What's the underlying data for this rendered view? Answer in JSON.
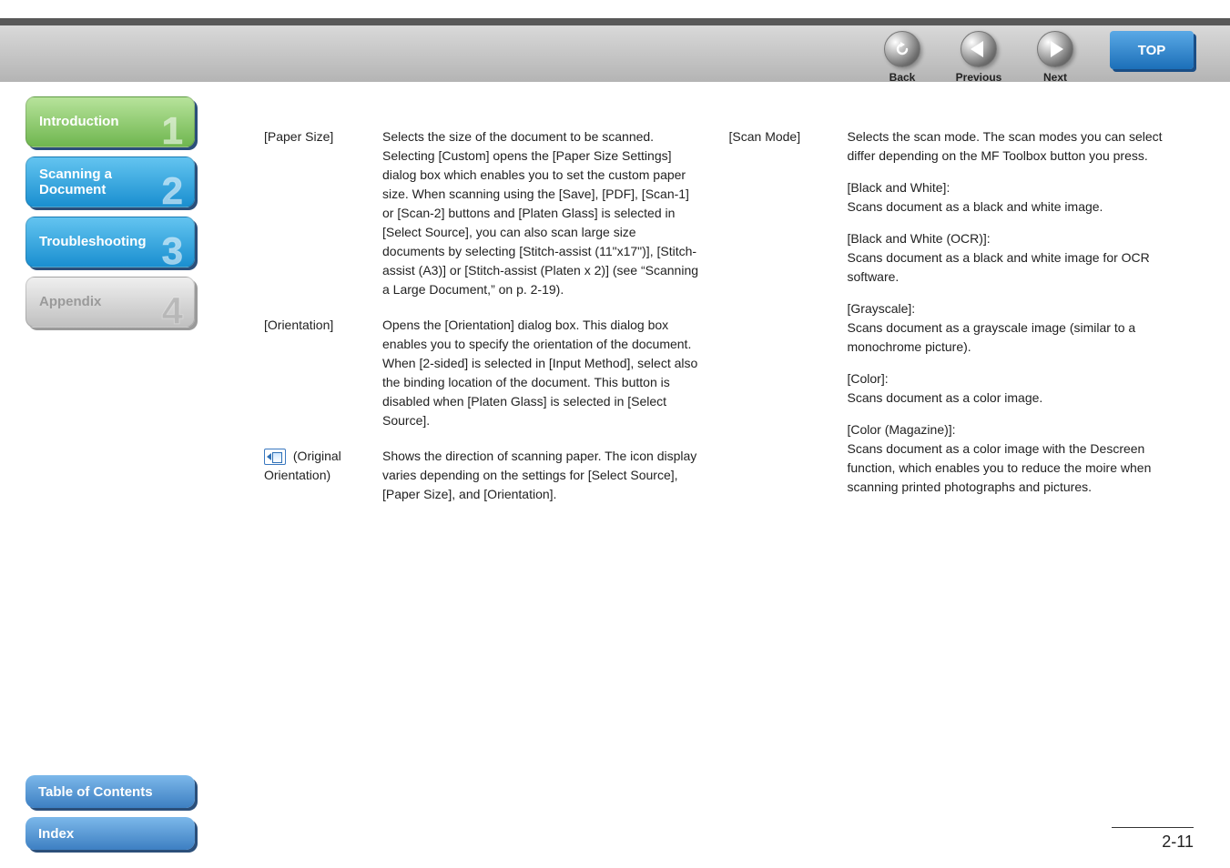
{
  "topnav": {
    "back": "Back",
    "previous": "Previous",
    "next": "Next",
    "top": "TOP"
  },
  "sidebar": {
    "items": [
      {
        "label": "Introduction",
        "num": "1"
      },
      {
        "label": "Scanning a Document",
        "num": "2"
      },
      {
        "label": "Troubleshooting",
        "num": "3"
      },
      {
        "label": "Appendix",
        "num": "4"
      }
    ]
  },
  "bottom": {
    "toc": "Table of Contents",
    "index": "Index"
  },
  "pageno": "2-11",
  "left_col": [
    {
      "term": "[Paper Size]",
      "desc": "Selects the size of the document to be scanned. Selecting [Custom] opens the [Paper Size Settings] dialog box which enables you to set the custom paper size. When scanning using the [Save], [PDF], [Scan-1] or [Scan-2] buttons and [Platen Glass] is selected in [Select Source], you can also scan large size documents by selecting [Stitch-assist (11\"x17\")], [Stitch-assist (A3)] or [Stitch-assist (Platen x 2)] (see “Scanning a Large Document,” on p. 2-19)."
    },
    {
      "term": "[Orientation]",
      "desc": "Opens the [Orientation] dialog box. This dialog box enables you to specify the orientation of the document. When [2-sided] is selected in [Input Method], select also the binding location of the document. This button is disabled when [Platen Glass] is selected in [Select Source]."
    },
    {
      "term": " (Original Orientation)",
      "has_icon": true,
      "desc": "Shows the direction of scanning paper. The icon display varies depending on the settings for [Select Source], [Paper Size], and [Orientation]."
    }
  ],
  "right_col": {
    "term": "[Scan Mode]",
    "desc": "Selects the scan mode. The scan modes you can select differ depending on the MF Toolbox button you press.",
    "modes": [
      {
        "head": "[Black and White]:",
        "body": "Scans document as a black and white image."
      },
      {
        "head": "[Black and White (OCR)]:",
        "body": "Scans document as a black and white image for OCR software."
      },
      {
        "head": "[Grayscale]:",
        "body": "Scans document as a grayscale image (similar to a monochrome picture)."
      },
      {
        "head": "[Color]:",
        "body": "Scans document as a color image."
      },
      {
        "head": "[Color (Magazine)]:",
        "body": "Scans document as a color image with the Descreen function, which enables you to reduce the moire when scanning printed photographs and pictures."
      }
    ]
  }
}
